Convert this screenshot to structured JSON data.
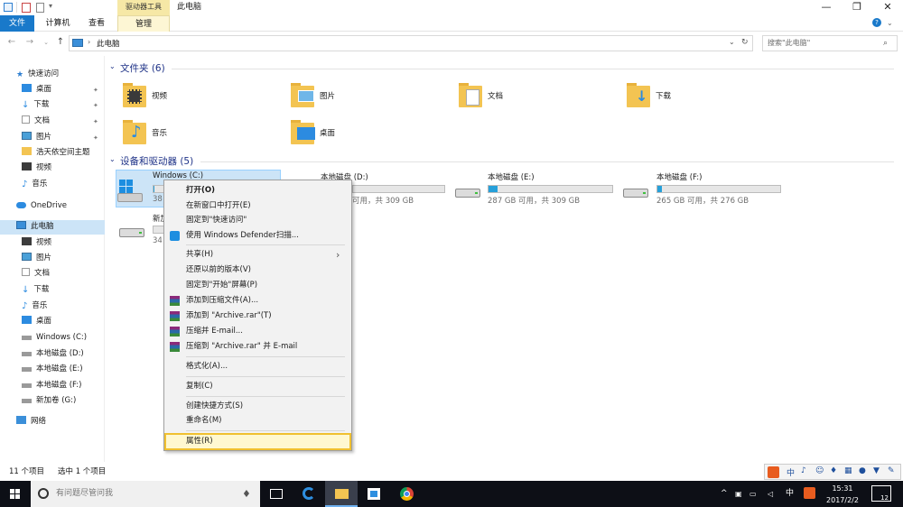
{
  "window": {
    "title": "此电脑",
    "tools_tab": "驱动器工具",
    "min": "—",
    "max": "❐",
    "close": "✕"
  },
  "ribbon": {
    "tabs": [
      "文件",
      "计算机",
      "查看",
      "管理"
    ]
  },
  "address": {
    "path": "此电脑",
    "search_placeholder": "搜索\"此电脑\""
  },
  "sidebar": {
    "items": [
      {
        "label": "快速访问"
      },
      {
        "label": "桌面"
      },
      {
        "label": "下载"
      },
      {
        "label": "文档"
      },
      {
        "label": "图片"
      },
      {
        "label": "浩天依空间主题"
      },
      {
        "label": "视频"
      },
      {
        "label": "音乐"
      },
      {
        "label": "OneDrive"
      },
      {
        "label": "此电脑"
      },
      {
        "label": "视频"
      },
      {
        "label": "图片"
      },
      {
        "label": "文档"
      },
      {
        "label": "下载"
      },
      {
        "label": "音乐"
      },
      {
        "label": "桌面"
      },
      {
        "label": "Windows (C:)"
      },
      {
        "label": "本地磁盘 (D:)"
      },
      {
        "label": "本地磁盘 (E:)"
      },
      {
        "label": "本地磁盘 (F:)"
      },
      {
        "label": "新加卷 (G:)"
      },
      {
        "label": "网络"
      }
    ]
  },
  "content": {
    "folders_header": "文件夹 (6)",
    "folders": [
      {
        "label": "视频"
      },
      {
        "label": "图片"
      },
      {
        "label": "文档"
      },
      {
        "label": "下载"
      },
      {
        "label": "音乐"
      },
      {
        "label": "桌面"
      }
    ],
    "drives_header": "设备和驱动器 (5)",
    "drives": [
      {
        "name": "Windows (C:)",
        "info": "38",
        "fill": 0.08
      },
      {
        "name": "本地磁盘 (D:)",
        "info": "可用，共 309 GB",
        "fill": 0.0
      },
      {
        "name": "本地磁盘 (E:)",
        "info": "287 GB 可用，共 309 GB",
        "fill": 0.07
      },
      {
        "name": "本地磁盘 (F:)",
        "info": "265 GB 可用，共 276 GB",
        "fill": 0.04
      },
      {
        "name": "新加",
        "info": "34",
        "fill": 0.0
      }
    ]
  },
  "status": {
    "count": "11 个项目",
    "selected": "选中 1 个项目"
  },
  "context_menu": {
    "items": [
      "打开(O)",
      "在新窗口中打开(E)",
      "固定到\"快速访问\"",
      "使用 Windows Defender扫描...",
      "共享(H)",
      "还原以前的版本(V)",
      "固定到\"开始\"屏幕(P)",
      "添加到压缩文件(A)...",
      "添加到 \"Archive.rar\"(T)",
      "压缩并 E-mail...",
      "压缩到 \"Archive.rar\" 并 E-mail",
      "格式化(A)...",
      "复制(C)",
      "创建快捷方式(S)",
      "重命名(M)",
      "属性(R)"
    ],
    "submenu_arrow": "›"
  },
  "taskbar": {
    "cortana_text": "有问题尽管问我",
    "time": "15:31",
    "date": "2017/2/2",
    "lang": "中",
    "notify": "12"
  },
  "ime": {
    "label": "中"
  },
  "colors": {
    "accent": "#1979ca",
    "selection": "#cce4f7",
    "highlight": "#f0c030"
  }
}
